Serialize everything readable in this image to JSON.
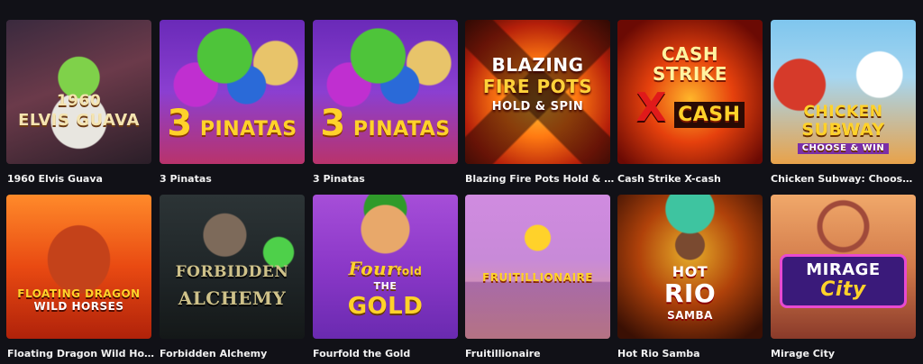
{
  "games": [
    {
      "title": "1960 Elvis Guava",
      "logo": [
        "1960",
        "ELVIS GUAVA"
      ]
    },
    {
      "title": "3 Pinatas",
      "logo": [
        "3",
        "PINATAS"
      ]
    },
    {
      "title": "3 Pinatas",
      "logo": [
        "3",
        "PINATAS"
      ]
    },
    {
      "title": "Blazing Fire Pots Hold & Spin",
      "logo": [
        "BLAZING",
        "FIRE POTS",
        "HOLD & SPIN"
      ]
    },
    {
      "title": "Cash Strike X-cash",
      "logo": [
        "CASH",
        "STRIKE",
        "X",
        "CASH"
      ]
    },
    {
      "title": "Chicken Subway: Choose and ...",
      "logo": [
        "CHICKEN",
        "SUBWAY",
        "CHOOSE & WIN"
      ]
    },
    {
      "title": "Floating Dragon Wild Horses",
      "logo": [
        "FLOATING DRAGON",
        "WILD HORSES"
      ]
    },
    {
      "title": "Forbidden Alchemy",
      "logo": [
        "FORBIDDEN",
        "ALCHEMY"
      ]
    },
    {
      "title": "Fourfold the Gold",
      "logo": [
        "Four",
        "fold",
        "THE",
        "GOLD"
      ]
    },
    {
      "title": "Fruitillionaire",
      "logo": [
        "FRUITILLIONAIRE"
      ]
    },
    {
      "title": "Hot Rio Samba",
      "logo": [
        "HOT",
        "RIO",
        "SAMBA"
      ]
    },
    {
      "title": "Mirage City",
      "logo": [
        "MIRAGE",
        "City"
      ]
    }
  ]
}
